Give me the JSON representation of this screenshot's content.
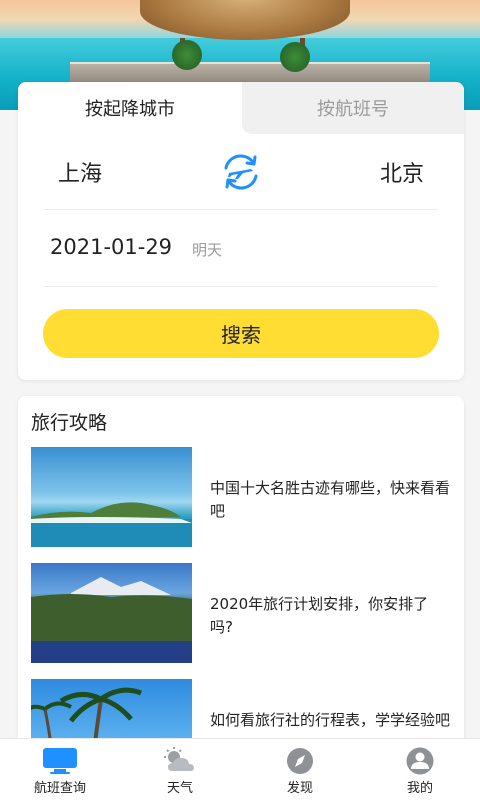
{
  "search": {
    "tabs": [
      {
        "label": "按起降城市",
        "active": true
      },
      {
        "label": "按航班号",
        "active": false
      }
    ],
    "from_city": "上海",
    "to_city": "北京",
    "swap_icon": "plane-swap-icon",
    "date": "2021-01-29",
    "date_hint": "明天",
    "button_label": "搜索"
  },
  "guide": {
    "title": "旅行攻略",
    "articles": [
      {
        "title": "中国十大名胜古迹有哪些，快来看看吧",
        "image": "beach-island-photo"
      },
      {
        "title": "2020年旅行计划安排，你安排了吗?",
        "image": "mountain-lake-photo"
      },
      {
        "title": "如何看旅行社的行程表，学学经验吧",
        "image": "palm-tree-photo"
      }
    ]
  },
  "nav": {
    "items": [
      {
        "label": "航班查询",
        "icon": "monitor-icon",
        "active": true
      },
      {
        "label": "天气",
        "icon": "weather-icon",
        "active": false
      },
      {
        "label": "发现",
        "icon": "compass-icon",
        "active": false
      },
      {
        "label": "我的",
        "icon": "user-icon",
        "active": false
      }
    ]
  },
  "colors": {
    "accent_yellow": "#ffdd33",
    "accent_blue": "#1e90ff",
    "inactive_gray": "#9a9a9a"
  }
}
